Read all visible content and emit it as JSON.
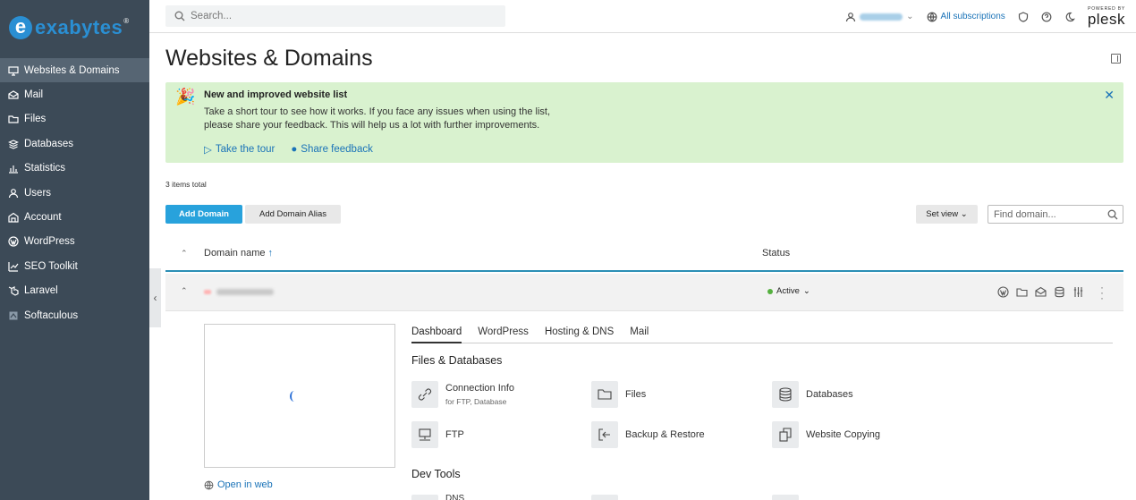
{
  "brand": {
    "name": "exabytes",
    "mark": "e",
    "reg": "®"
  },
  "sidebar": {
    "items": [
      {
        "label": "Websites & Domains",
        "icon": "monitor-icon",
        "active": true
      },
      {
        "label": "Mail",
        "icon": "mail-icon"
      },
      {
        "label": "Files",
        "icon": "folder-icon"
      },
      {
        "label": "Databases",
        "icon": "database-icon"
      },
      {
        "label": "Statistics",
        "icon": "statistics-icon"
      },
      {
        "label": "Users",
        "icon": "user-icon"
      },
      {
        "label": "Account",
        "icon": "account-icon"
      },
      {
        "label": "WordPress",
        "icon": "wordpress-icon"
      },
      {
        "label": "SEO Toolkit",
        "icon": "seo-icon"
      },
      {
        "label": "Laravel",
        "icon": "laravel-icon"
      },
      {
        "label": "Softaculous",
        "icon": "softaculous-icon"
      }
    ],
    "collapse_glyph": "‹"
  },
  "topbar": {
    "search_placeholder": "Search...",
    "subscriptions_label": "All subscriptions",
    "powered_by": "POWERED BY",
    "plesk": "plesk"
  },
  "page": {
    "title": "Websites & Domains"
  },
  "banner": {
    "emoji": "🎉",
    "title": "New and improved website list",
    "text_line1": "Take a short tour to see how it works. If you face any issues when using the list,",
    "text_line2": "please share your feedback. This will help us a lot with further improvements.",
    "tour_label": "Take the tour",
    "feedback_label": "Share feedback",
    "close": "✕"
  },
  "list": {
    "items_total": "3 items total",
    "add_domain": "Add Domain",
    "add_alias": "Add Domain Alias",
    "set_view": "Set view",
    "find_placeholder": "Find domain...",
    "col_domain": "Domain name",
    "sort_arrow": "↑",
    "col_status": "Status"
  },
  "domain": {
    "status": "Active",
    "status_color": "#55b03f",
    "open_in_web": "Open in web",
    "tabs": [
      "Dashboard",
      "WordPress",
      "Hosting & DNS",
      "Mail"
    ],
    "active_tab": "Dashboard",
    "files_section": "Files & Databases",
    "tools": [
      {
        "label": "Connection Info",
        "sub": "for FTP, Database",
        "icon": "connection-icon"
      },
      {
        "label": "Files",
        "icon": "folder-icon"
      },
      {
        "label": "Databases",
        "icon": "database-icon"
      },
      {
        "label": "FTP",
        "icon": "ftp-icon"
      },
      {
        "label": "Backup & Restore",
        "icon": "backup-icon"
      },
      {
        "label": "Website Copying",
        "icon": "copy-icon"
      }
    ],
    "dev_section": "Dev Tools",
    "dev_partial": "DNS"
  },
  "colors": {
    "sidebar": "#3c4a57",
    "accent": "#28a2dc",
    "banner": "#d9f2cf",
    "link": "#1a73b8"
  }
}
